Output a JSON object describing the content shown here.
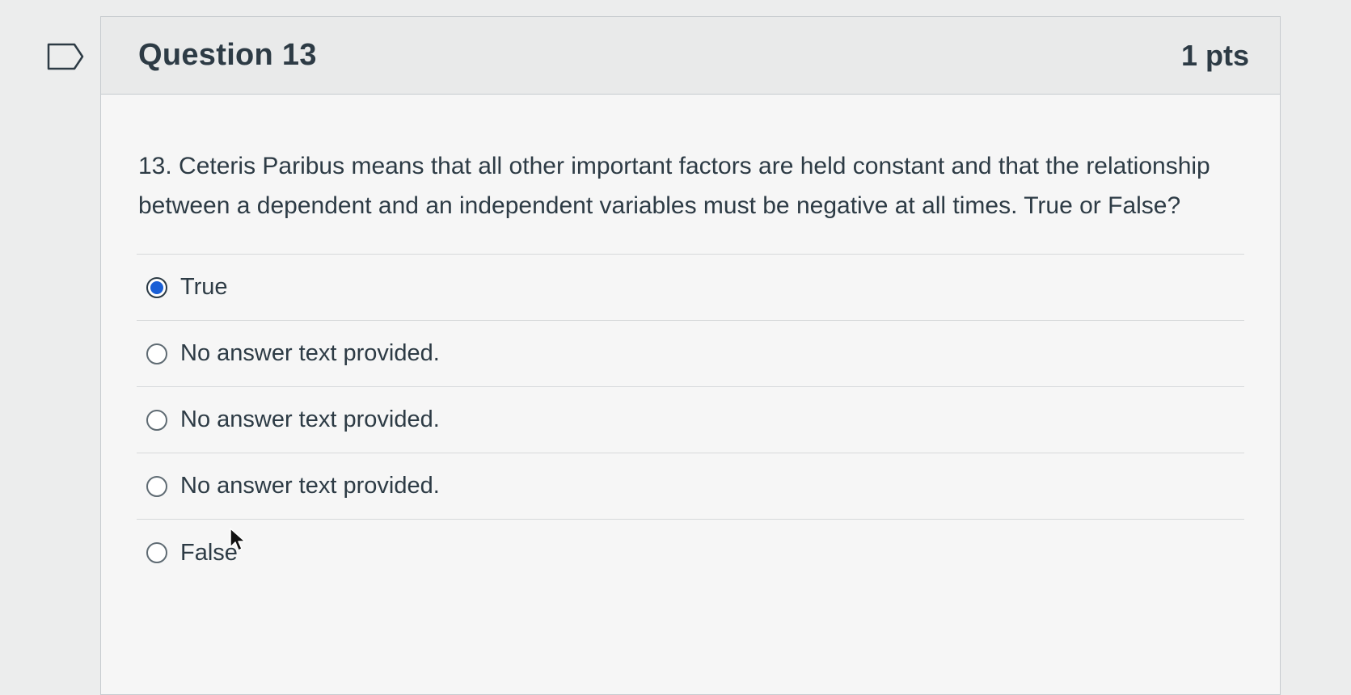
{
  "question": {
    "title": "Question 13",
    "points": "1 pts",
    "text": "13. Ceteris Paribus means that all other important factors are held constant and that the relationship between a dependent and an independent variables must be negative at all times. True or False?",
    "answers": [
      {
        "label": "True",
        "selected": true
      },
      {
        "label": "No answer text provided.",
        "selected": false
      },
      {
        "label": "No answer text provided.",
        "selected": false
      },
      {
        "label": "No answer text provided.",
        "selected": false
      },
      {
        "label": "False",
        "selected": false
      }
    ]
  },
  "icons": {
    "flag": "flag-icon",
    "cursor": "mouse-cursor-icon"
  },
  "colors": {
    "selected_radio": "#1a5fd6",
    "header_bg": "#e9eaea",
    "text": "#2d3b45"
  }
}
